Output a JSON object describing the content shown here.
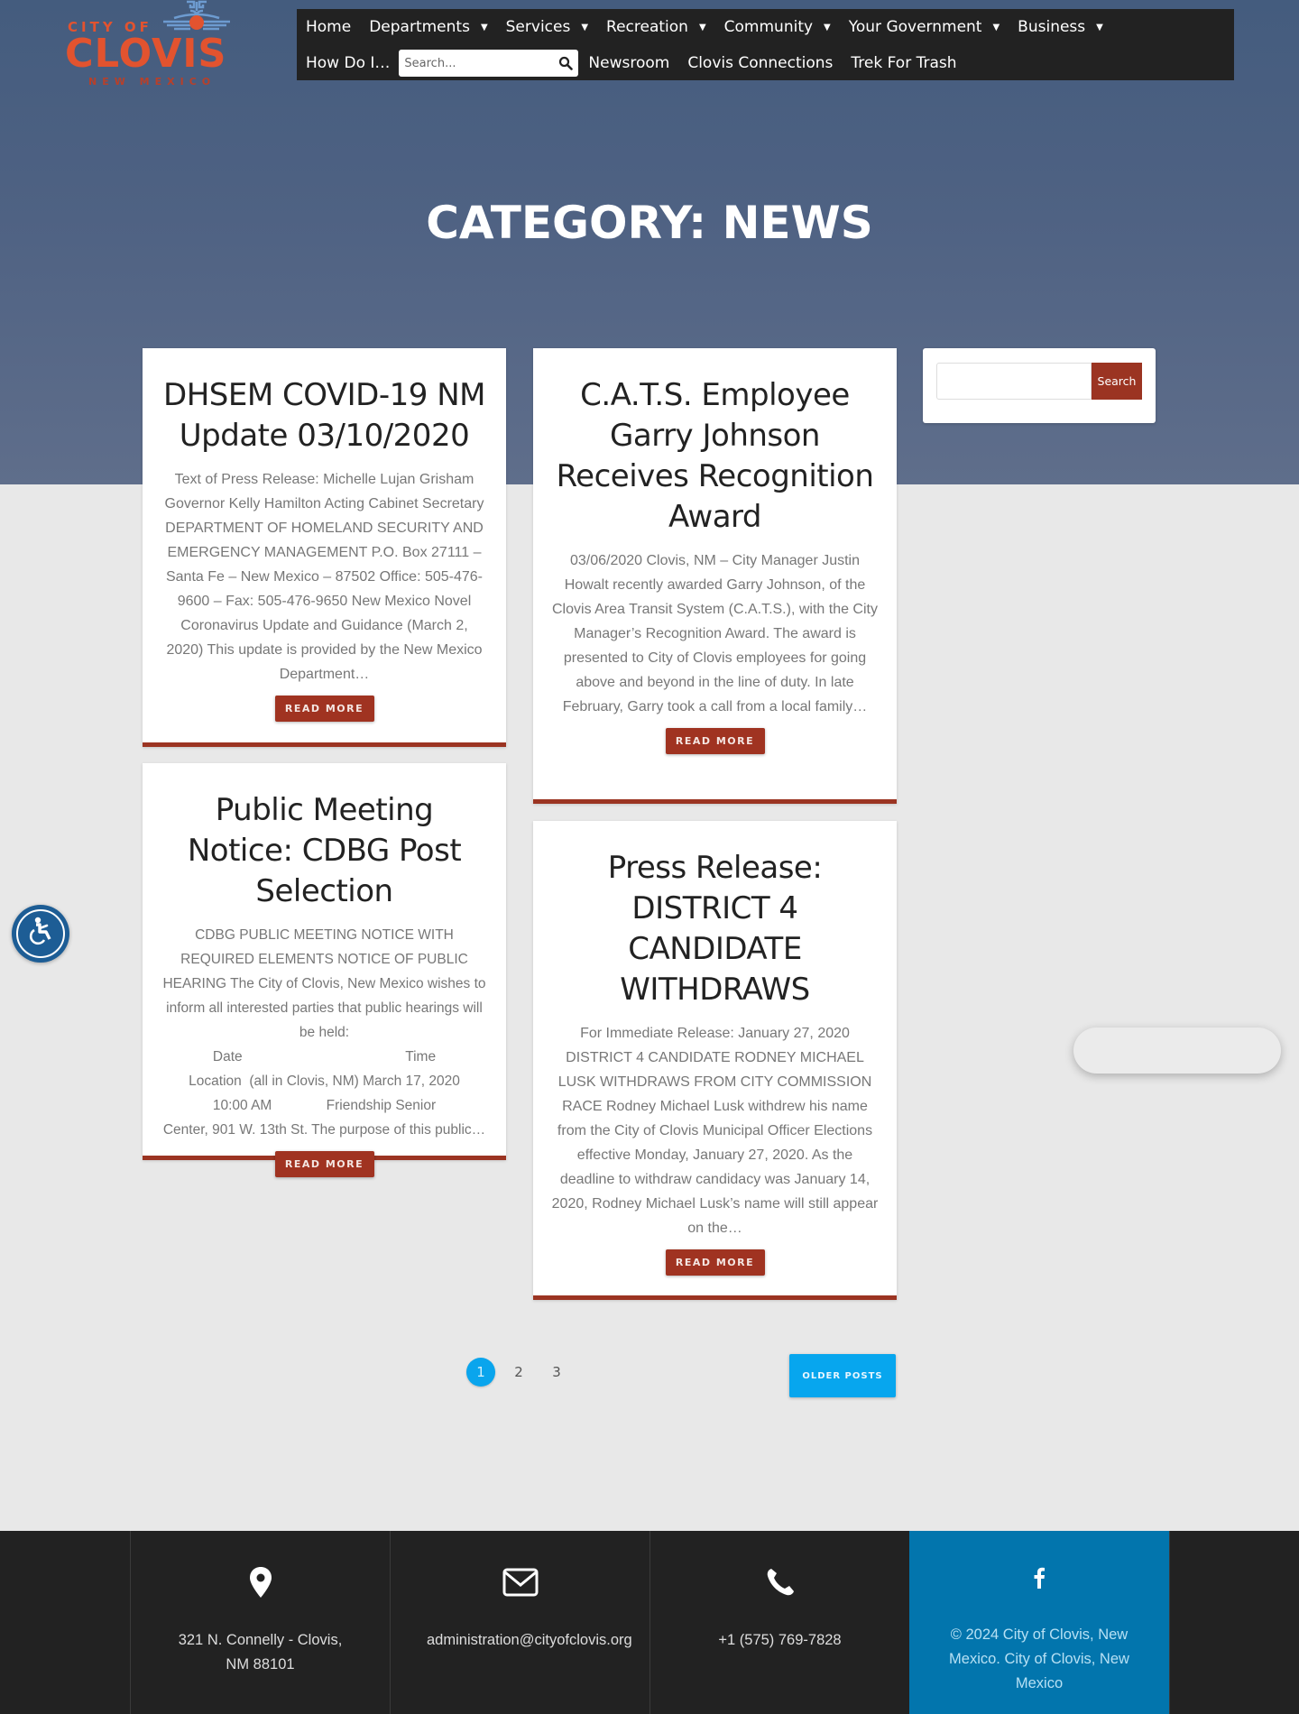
{
  "logo": {
    "line1": "CITY OF",
    "line2": "CLOVIS",
    "line3": "NEW MEXICO"
  },
  "nav": {
    "row1": [
      {
        "label": "Home",
        "has_dropdown": false
      },
      {
        "label": "Departments",
        "has_dropdown": true
      },
      {
        "label": "Services",
        "has_dropdown": true
      },
      {
        "label": "Recreation",
        "has_dropdown": true
      },
      {
        "label": "Community",
        "has_dropdown": true
      },
      {
        "label": "Your Government",
        "has_dropdown": true
      },
      {
        "label": "Business",
        "has_dropdown": true
      }
    ],
    "how_do_i": "How Do I…",
    "search_placeholder": "Search...",
    "row2": [
      {
        "label": "Newsroom"
      },
      {
        "label": "Clovis Connections"
      },
      {
        "label": "Trek For Trash"
      }
    ],
    "dropdown_caret": "▼"
  },
  "page_title": "CATEGORY: NEWS",
  "posts": [
    {
      "title": "DHSEM COVID-19 NM Update 03/10/2020",
      "excerpt": "Text of Press Release: Michelle Lujan Grisham Governor Kelly Hamilton Acting Cabinet Secretary DEPARTMENT OF HOMELAND SECURITY AND EMERGENCY MANAGEMENT P.O. Box 27111 – Santa Fe –  New Mexico – 87502 Office: 505-476-9600 – Fax: 505-476-9650 New Mexico Novel Coronavirus Update and Guidance (March 2, 2020) This update is provided by the New Mexico Department…",
      "button": "READ MORE"
    },
    {
      "title": "C.A.T.S. Employee Garry Johnson Receives Recognition Award",
      "excerpt": "03/06/2020 Clovis, NM – City Manager Justin Howalt recently awarded Garry Johnson, of the Clovis Area Transit System (C.A.T.S.), with the City Manager’s Recognition Award. The award is presented to City of Clovis employees for going above and beyond in the line of duty. In late February, Garry took a call from a local family…",
      "button": "READ MORE"
    },
    {
      "title": "Public Meeting Notice: CDBG Post Selection",
      "excerpt": "CDBG PUBLIC MEETING NOTICE WITH REQUIRED ELEMENTS NOTICE OF PUBLIC HEARING The City of Clovis, New Mexico wishes to inform all interested parties that public hearings will be held:",
      "excerpt_table": "Date                                          Time\nLocation  (all in Clovis, NM) March 17, 2020\n10:00 AM              Friendship Senior\nCenter, 901 W. 13th St. The purpose of this public…",
      "button": "READ MORE"
    },
    {
      "title": "Press Release: DISTRICT 4 CANDIDATE WITHDRAWS",
      "excerpt": "For Immediate Release: January 27, 2020 DISTRICT 4 CANDIDATE RODNEY MICHAEL LUSK WITHDRAWS FROM CITY COMMISSION RACE Rodney Michael Lusk withdrew his name from the City of Clovis Municipal Officer Elections effective Monday, January 27, 2020. As the deadline to withdraw candidacy was January 14, 2020, Rodney Michael Lusk’s name will still appear on the…",
      "button": "READ MORE"
    }
  ],
  "sidebar": {
    "search_value": "",
    "search_button": "Search"
  },
  "pagination": {
    "pages": [
      "1",
      "2",
      "3"
    ],
    "current": "1",
    "older_posts": "OLDER POSTS"
  },
  "footer": {
    "address": "321 N. Connelly - Clovis, NM 88101",
    "email": "administration@cityofclovis.org",
    "phone": "+1 (575) 769-7828",
    "copyright": "©  2024 City of Clovis, New Mexico. City of Clovis, New Mexico",
    "icons": [
      "map-marker-icon",
      "envelope-icon",
      "phone-icon",
      "facebook-icon"
    ]
  },
  "colors": {
    "brand_red": "#a03321",
    "accent_blue": "#07a6ee",
    "footer_blue": "#0275ad",
    "nav_bg": "#222222",
    "logo_orange": "#e2532f"
  }
}
